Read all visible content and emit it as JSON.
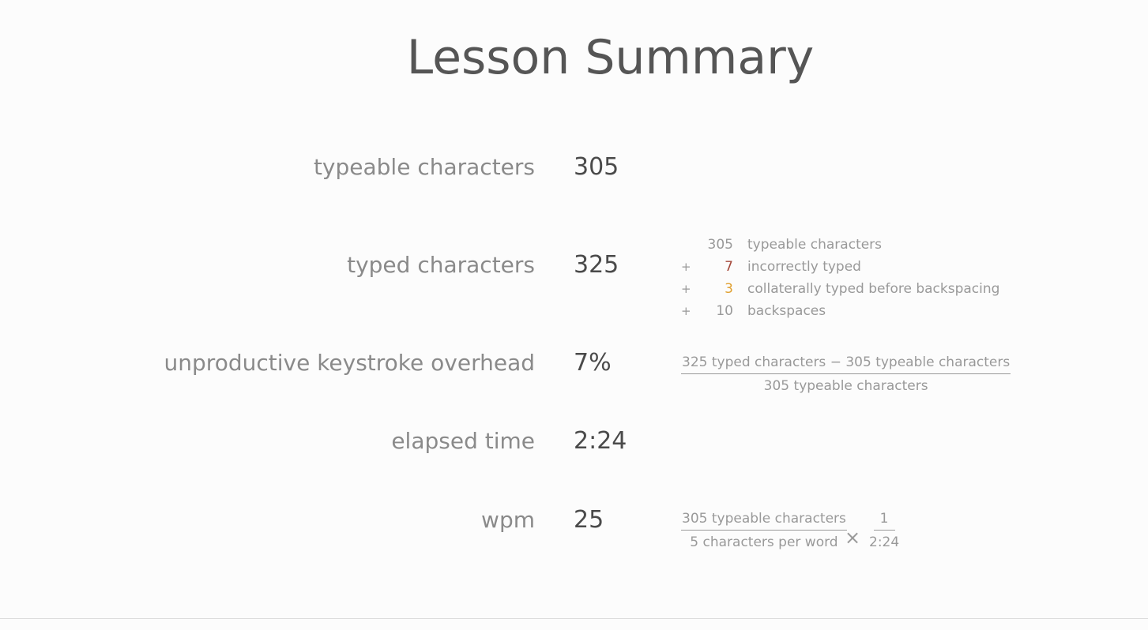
{
  "page_title": "Lesson Summary",
  "stats": [
    {
      "label": "typeable characters",
      "value": "305"
    },
    {
      "label": "typed characters",
      "value": "325"
    },
    {
      "label": "unproductive keystroke overhead",
      "value": "7%"
    },
    {
      "label": "elapsed time",
      "value": "2:24"
    },
    {
      "label": "wpm",
      "value": "25"
    }
  ],
  "breakdown": [
    {
      "sign": "",
      "number": "305",
      "text": "typeable characters",
      "color": "#999999"
    },
    {
      "sign": "+",
      "number": "7",
      "text": "incorrectly typed",
      "color": "#a54a3c"
    },
    {
      "sign": "+",
      "number": "3",
      "text": "collaterally typed before backspacing",
      "color": "#e0a030"
    },
    {
      "sign": "+",
      "number": "10",
      "text": "backspaces",
      "color": "#999999"
    }
  ],
  "overhead_formula": {
    "numerator": "325 typed characters − 305 typeable characters",
    "denominator": "305 typeable characters"
  },
  "wpm_formula": {
    "fraction1": {
      "numerator": "305 typeable characters",
      "denominator": "5 characters per word"
    },
    "operator": "×",
    "fraction2": {
      "numerator": "1",
      "denominator": "2:24"
    }
  }
}
